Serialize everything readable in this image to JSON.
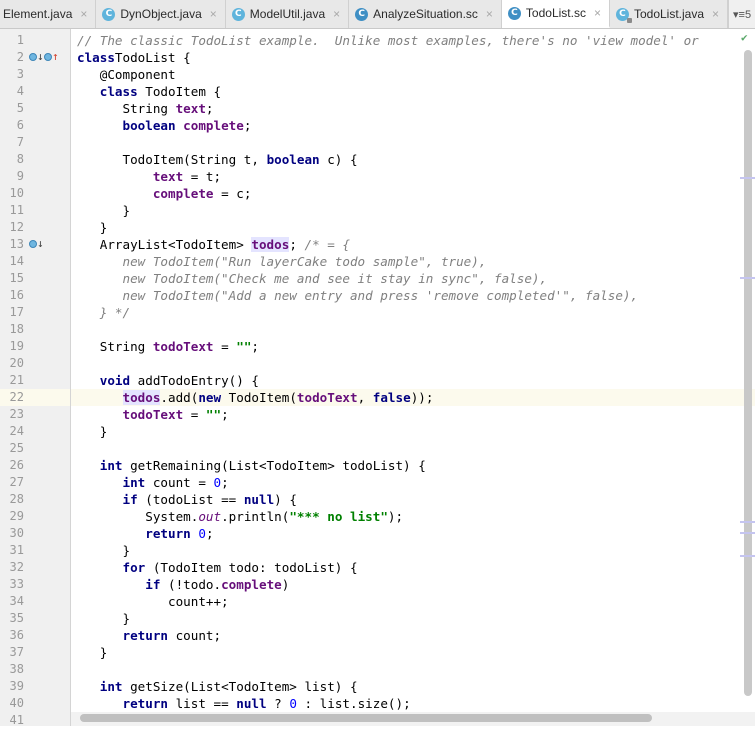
{
  "tabs": [
    {
      "label": "Element.java",
      "icon": "none",
      "active": false
    },
    {
      "label": "DynObject.java",
      "icon": "class-icon",
      "active": false
    },
    {
      "label": "ModelUtil.java",
      "icon": "class-icon",
      "active": false
    },
    {
      "label": "AnalyzeSituation.sc",
      "icon": "class-icon",
      "active": false
    },
    {
      "label": "TodoList.sc",
      "icon": "class-icon",
      "active": true
    },
    {
      "label": "TodoList.java",
      "icon": "class-locked-icon",
      "active": false
    }
  ],
  "tab_close_glyph": "×",
  "tab_overflow": {
    "glyph": "▾≡",
    "count": "5"
  },
  "class_icon_letter": "C",
  "current_line": 22,
  "line_numbers": [
    "1",
    "2",
    "3",
    "4",
    "5",
    "6",
    "7",
    "8",
    "9",
    "10",
    "11",
    "12",
    "13",
    "14",
    "15",
    "16",
    "17",
    "18",
    "19",
    "20",
    "21",
    "22",
    "23",
    "24",
    "25",
    "26",
    "27",
    "28",
    "29",
    "30",
    "31",
    "32",
    "33",
    "34",
    "35",
    "36",
    "37",
    "38",
    "39",
    "40",
    "41"
  ],
  "gutter_icons": {
    "line2": [
      "overridden-down-icon",
      "implements-up-icon"
    ],
    "line13": [
      "overridden-down-icon"
    ]
  },
  "code_lines": [
    [
      [
        "cm",
        "// The classic TodoList example.  Unlike most examples, there's no 'view model' or "
      ]
    ],
    [
      [
        "kw",
        "class"
      ],
      [
        "",
        "TodoList {"
      ]
    ],
    [
      [
        "",
        "   @Component"
      ]
    ],
    [
      [
        "",
        "   "
      ],
      [
        "kw",
        "class"
      ],
      [
        "",
        " TodoItem {"
      ]
    ],
    [
      [
        "",
        "      String "
      ],
      [
        "fld",
        "text"
      ],
      [
        "",
        ";"
      ]
    ],
    [
      [
        "",
        "      "
      ],
      [
        "kw",
        "boolean"
      ],
      [
        "",
        " "
      ],
      [
        "fld",
        "complete"
      ],
      [
        "",
        ";"
      ]
    ],
    [
      [
        "",
        ""
      ]
    ],
    [
      [
        "",
        "      TodoItem(String t, "
      ],
      [
        "kw",
        "boolean"
      ],
      [
        "",
        " c) {"
      ]
    ],
    [
      [
        "",
        "          "
      ],
      [
        "fld",
        "text"
      ],
      [
        "",
        " = t;"
      ]
    ],
    [
      [
        "",
        "          "
      ],
      [
        "fld",
        "complete"
      ],
      [
        "",
        " = c;"
      ]
    ],
    [
      [
        "",
        "      }"
      ]
    ],
    [
      [
        "",
        "   }"
      ]
    ],
    [
      [
        "",
        "   ArrayList<TodoItem> "
      ],
      [
        "fld hl",
        "todos"
      ],
      [
        "",
        "; "
      ],
      [
        "cm",
        "/* = {"
      ]
    ],
    [
      [
        "cm",
        "      new TodoItem(\"Run layerCake todo sample\", true),"
      ]
    ],
    [
      [
        "cm",
        "      new TodoItem(\"Check me and see it stay in sync\", false),"
      ]
    ],
    [
      [
        "cm",
        "      new TodoItem(\"Add a new entry and press 'remove completed'\", false),"
      ]
    ],
    [
      [
        "cm",
        "   } */"
      ]
    ],
    [
      [
        "",
        ""
      ]
    ],
    [
      [
        "",
        "   String "
      ],
      [
        "fld",
        "todoText"
      ],
      [
        "",
        " = "
      ],
      [
        "str",
        "\"\""
      ],
      [
        "",
        ";"
      ]
    ],
    [
      [
        "",
        ""
      ]
    ],
    [
      [
        "",
        "   "
      ],
      [
        "kw",
        "void"
      ],
      [
        "",
        " addTodoEntry() {"
      ]
    ],
    [
      [
        "",
        "      "
      ],
      [
        "fld hl",
        "todos"
      ],
      [
        "",
        ".add("
      ],
      [
        "kw",
        "new"
      ],
      [
        "",
        " TodoItem("
      ],
      [
        "fld",
        "todoText"
      ],
      [
        "",
        ", "
      ],
      [
        "kw",
        "false"
      ],
      [
        "",
        "));"
      ]
    ],
    [
      [
        "",
        "      "
      ],
      [
        "fld",
        "todoText"
      ],
      [
        "",
        " = "
      ],
      [
        "str",
        "\"\""
      ],
      [
        "",
        ";"
      ]
    ],
    [
      [
        "",
        "   }"
      ]
    ],
    [
      [
        "",
        ""
      ]
    ],
    [
      [
        "",
        "   "
      ],
      [
        "kw",
        "int"
      ],
      [
        "",
        " getRemaining(List<TodoItem> todoList) {"
      ]
    ],
    [
      [
        "",
        "      "
      ],
      [
        "kw",
        "int"
      ],
      [
        "",
        " count = "
      ],
      [
        "num",
        "0"
      ],
      [
        "",
        ";"
      ]
    ],
    [
      [
        "",
        "      "
      ],
      [
        "kw",
        "if"
      ],
      [
        "",
        " (todoList == "
      ],
      [
        "kw",
        "null"
      ],
      [
        "",
        ") {"
      ]
    ],
    [
      [
        "",
        "         System."
      ],
      [
        "stat",
        "out"
      ],
      [
        "",
        ".println("
      ],
      [
        "str",
        "\"*** no list\""
      ],
      [
        "",
        ");"
      ]
    ],
    [
      [
        "",
        "         "
      ],
      [
        "kw",
        "return"
      ],
      [
        "",
        " "
      ],
      [
        "num",
        "0"
      ],
      [
        "",
        ";"
      ]
    ],
    [
      [
        "",
        "      }"
      ]
    ],
    [
      [
        "",
        "      "
      ],
      [
        "kw",
        "for"
      ],
      [
        "",
        " (TodoItem todo: todoList) {"
      ]
    ],
    [
      [
        "",
        "         "
      ],
      [
        "kw",
        "if"
      ],
      [
        "",
        " (!todo."
      ],
      [
        "fld",
        "complete"
      ],
      [
        "",
        ")"
      ]
    ],
    [
      [
        "",
        "            count++;"
      ]
    ],
    [
      [
        "",
        "      }"
      ]
    ],
    [
      [
        "",
        "      "
      ],
      [
        "kw",
        "return"
      ],
      [
        "",
        " count;"
      ]
    ],
    [
      [
        "",
        "   }"
      ]
    ],
    [
      [
        "",
        ""
      ]
    ],
    [
      [
        "",
        "   "
      ],
      [
        "kw",
        "int"
      ],
      [
        "",
        " getSize(List<TodoItem> list) {"
      ]
    ],
    [
      [
        "",
        "      "
      ],
      [
        "kw",
        "return"
      ],
      [
        "",
        " list == "
      ],
      [
        "kw",
        "null"
      ],
      [
        "",
        " ? "
      ],
      [
        "num",
        "0"
      ],
      [
        "",
        " : list.size();"
      ]
    ],
    [
      [
        "",
        ""
      ]
    ]
  ],
  "inspection_status": "ok-check-icon",
  "scrollbar_markers": 6
}
